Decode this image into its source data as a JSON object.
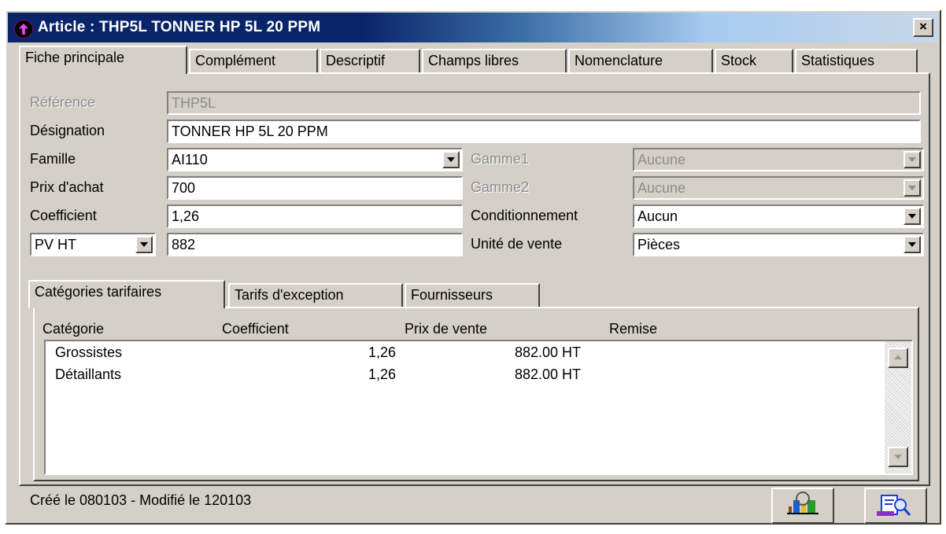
{
  "window": {
    "title": "Article : THP5L TONNER HP 5L  20 PPM",
    "close_glyph": "×"
  },
  "main_tabs": [
    {
      "label": "Fiche principale",
      "active": true
    },
    {
      "label": "Complément"
    },
    {
      "label": "Descriptif"
    },
    {
      "label": "Champs libres"
    },
    {
      "label": "Nomenclature"
    },
    {
      "label": "Stock"
    },
    {
      "label": "Statistiques"
    }
  ],
  "form": {
    "reference_label": "Référence",
    "reference_value": "THP5L",
    "designation_label": "Désignation",
    "designation_value": "TONNER HP 5L  20 PPM",
    "famille_label": "Famille",
    "famille_value": "AI110",
    "prix_achat_label": "Prix d'achat",
    "prix_achat_value": "700",
    "coefficient_label": "Coefficient",
    "coefficient_value": "1,26",
    "price_type_value": "PV HT",
    "price_value": "882",
    "gamme1_label": "Gamme1",
    "gamme1_value": "Aucune",
    "gamme2_label": "Gamme2",
    "gamme2_value": "Aucune",
    "conditionnement_label": "Conditionnement",
    "conditionnement_value": "Aucun",
    "unite_label": "Unité de vente",
    "unite_value": "Pièces"
  },
  "sub_tabs": [
    {
      "label": "Catégories tarifaires",
      "active": true
    },
    {
      "label": "Tarifs d'exception"
    },
    {
      "label": "Fournisseurs"
    }
  ],
  "table": {
    "columns": [
      "Catégorie",
      "Coefficient",
      "Prix de vente",
      "Remise"
    ],
    "rows": [
      {
        "categorie": "Grossistes",
        "coefficient": "1,26",
        "prix": "882.00 HT",
        "remise": ""
      },
      {
        "categorie": "Détaillants",
        "coefficient": "1,26",
        "prix": "882.00 HT",
        "remise": ""
      }
    ]
  },
  "status": {
    "text": "Créé le 080103 - Modifié le 120103"
  },
  "icons": {
    "statistics_button": "chart-bars-icon",
    "search_button": "document-magnifier-icon"
  },
  "colors": {
    "title_start": "#0a246a",
    "title_end": "#c8d8e8",
    "face": "#d4d0c8"
  }
}
